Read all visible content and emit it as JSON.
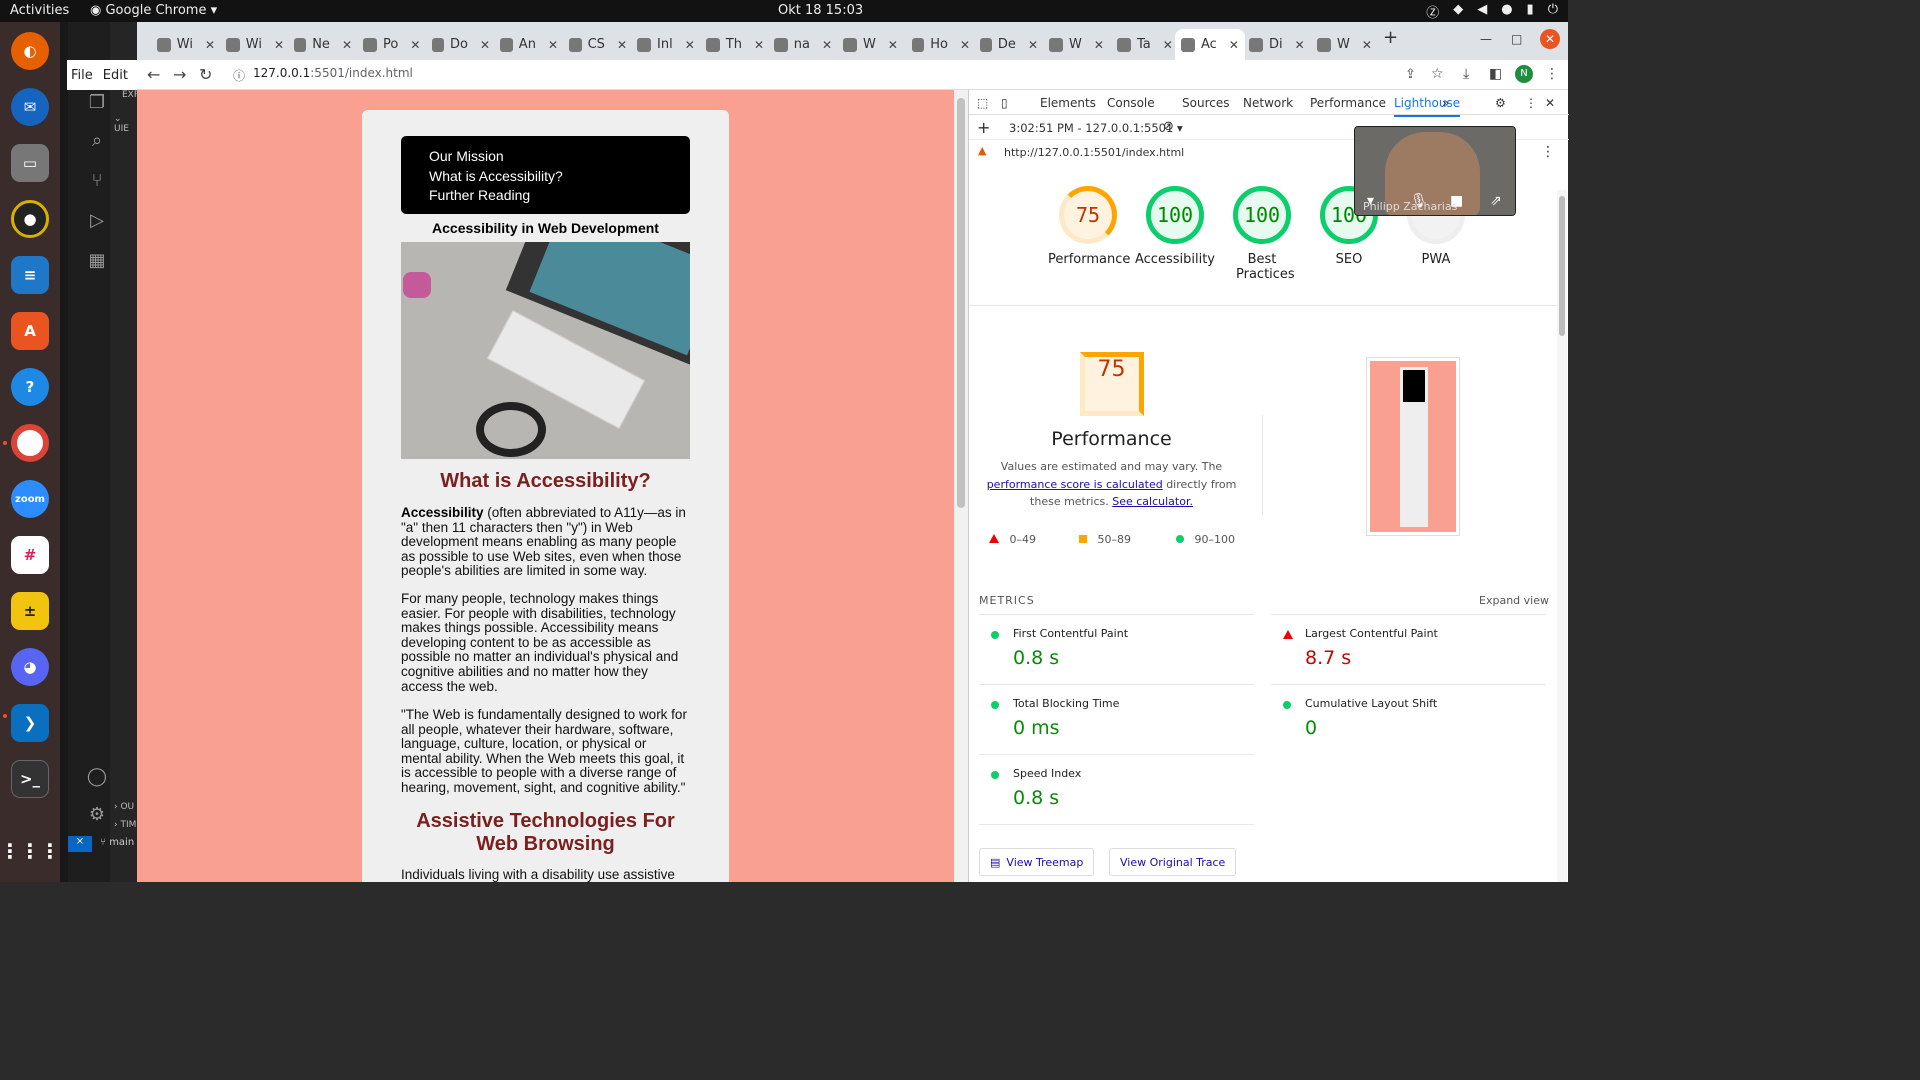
{
  "system": {
    "activities": "Activities",
    "app": "Google Chrome",
    "clock": "Okt 18  15:03"
  },
  "dock": {
    "items": [
      "firefox",
      "thunderbird",
      "files",
      "rhythmbox",
      "writer",
      "app-center",
      "help",
      "chrome",
      "zoom",
      "slack",
      "calculator",
      "discord",
      "vscode",
      "terminal",
      "apps-grid"
    ]
  },
  "vscode": {
    "menu_file": "File",
    "menu_edit": "Edit",
    "explorer": "EXP",
    "branch": "main",
    "panel1": "UIE",
    "outline": "OU",
    "timeline": "TIM"
  },
  "tabs": [
    {
      "label": "Wi"
    },
    {
      "label": "Wi"
    },
    {
      "label": "Ne"
    },
    {
      "label": "Po"
    },
    {
      "label": "Do"
    },
    {
      "label": "An"
    },
    {
      "label": "CS"
    },
    {
      "label": "Inl"
    },
    {
      "label": "Th"
    },
    {
      "label": "na"
    },
    {
      "label": "W"
    },
    {
      "label": "Ho"
    },
    {
      "label": "De"
    },
    {
      "label": "W"
    },
    {
      "label": "Ta"
    },
    {
      "label": "Ac"
    },
    {
      "label": "Di"
    },
    {
      "label": "W"
    }
  ],
  "address": {
    "host": "127.0.0.1",
    "path": ":5501/index.html"
  },
  "page": {
    "nav": [
      "Our Mission",
      "What is Accessibility?",
      "Further Reading"
    ],
    "heading": "Accessibility in Web Development",
    "h2a": "What is Accessibility?",
    "p1_bold": "Accessibility",
    "p1": " (often abbreviated to A11y—as in \"a\" then 11 characters then \"y\") in Web development means enabling as many people as possible to use Web sites, even when those people's abilities are limited in some way.",
    "p2": "For many people, technology makes things easier. For people with disabilities, technology makes things possible. Accessibility means developing content to be as accessible as possible no matter an individual's physical and cognitive abilities and no matter how they access the web.",
    "p3": "\"The Web is fundamentally designed to work for all people, whatever their hardware, software, language, culture, location, or physical or mental ability. When the Web meets this goal, it is accessible to people with a diverse range of hearing, movement, sight, and cognitive ability.\"",
    "h2b": "Assistive Technologies For Web Browsing",
    "p4": "Individuals living with a disability use assistive"
  },
  "devtools": {
    "tabs": [
      "Elements",
      "Console",
      "Sources",
      "Network",
      "Performance",
      "Lighthouse"
    ],
    "report": "3:02:51 PM - 127.0.0.1:5501",
    "url": "http://127.0.0.1:5501/index.html",
    "scores": [
      {
        "label": "Performance",
        "value": "75"
      },
      {
        "label": "Accessibility",
        "value": "100"
      },
      {
        "label": "Best Practices",
        "value": "100"
      },
      {
        "label": "SEO",
        "value": "100"
      },
      {
        "label": "PWA",
        "value": ""
      }
    ],
    "perf_title": "Performance",
    "perf_value": "75",
    "desc1": "Values are estimated and may vary. The ",
    "desc_link1": "performance score is calculated",
    "desc2": " directly from these metrics. ",
    "desc_link2": "See calculator.",
    "legend": [
      "0–49",
      "50–89",
      "90–100"
    ],
    "metrics_label": "METRICS",
    "expand": "Expand view",
    "metrics": [
      {
        "name": "First Contentful Paint",
        "value": "0.8 s"
      },
      {
        "name": "Largest Contentful Paint",
        "value": "8.7 s"
      },
      {
        "name": "Total Blocking Time",
        "value": "0 ms"
      },
      {
        "name": "Cumulative Layout Shift",
        "value": "0"
      },
      {
        "name": "Speed Index",
        "value": "0.8 s"
      }
    ],
    "btn_treemap": "View Treemap",
    "btn_trace": "View Original Trace"
  },
  "video": {
    "name": "Philipp Zacharias"
  }
}
